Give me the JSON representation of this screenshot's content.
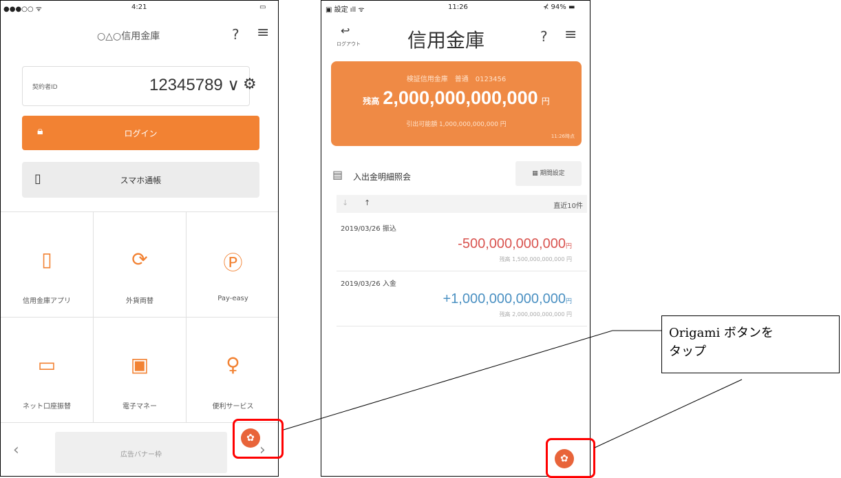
{
  "screen_left": {
    "status": {
      "carrier": "●●●○○ ᯤ",
      "time": "4:21",
      "battery": "▭"
    },
    "header": {
      "title": "○△○信用金庫",
      "help": "?",
      "menu": "≡"
    },
    "contract": {
      "label": "契約者ID",
      "id": "12345789 ∨"
    },
    "login_button": {
      "label": "ログイン"
    },
    "passbook_button": {
      "label": "スマホ通帳"
    },
    "grid": [
      {
        "label": "信用金庫アプリ",
        "icon": "▯"
      },
      {
        "label": "外貨両替",
        "icon": "⟳"
      },
      {
        "label": "Pay-easy",
        "icon": "Ⓟ"
      },
      {
        "label": "ネット口座振替",
        "icon": "▭"
      },
      {
        "label": "電子マネー",
        "icon": "▣"
      },
      {
        "label": "便利サービス",
        "icon": "♀"
      }
    ],
    "banner": {
      "label": "広告バナー枠",
      "prev": "‹",
      "next": "›"
    }
  },
  "screen_right": {
    "status": {
      "left": "▣ 設定 ıll ᯤ",
      "time": "11:26",
      "right": "⊀ 94% ▬"
    },
    "logout": {
      "icon": "↩",
      "label": "ログアウト"
    },
    "header": {
      "title": "信用金庫",
      "help": "?",
      "menu": "≡"
    },
    "balance": {
      "account": "検証信用金庫　普通　0123456",
      "label": "残高",
      "amount": "2,000,000,000,000",
      "unit": "円",
      "available": "引出可能額 1,000,000,000,000 円",
      "time": "11:26時点"
    },
    "inquiry": {
      "title": "入出金明細照会",
      "period_button": "期間設定"
    },
    "sort": {
      "recent": "直近10件"
    },
    "transactions": [
      {
        "date": "2019/03/26",
        "type": "振込",
        "amount": "-500,000,000,000",
        "unit": "円",
        "balance": "残高 1,500,000,000,000 円",
        "color": "#d9534f"
      },
      {
        "date": "2019/03/26",
        "type": "入金",
        "amount": "+1,000,000,000,000",
        "unit": "円",
        "balance": "残高 2,000,000,000,000 円",
        "color": "#4a90c2"
      }
    ]
  },
  "callout": {
    "line1": "Origami ボタンを",
    "line2": "タップ"
  },
  "colors": {
    "accent": "#f28233",
    "highlight": "#ff0000"
  }
}
